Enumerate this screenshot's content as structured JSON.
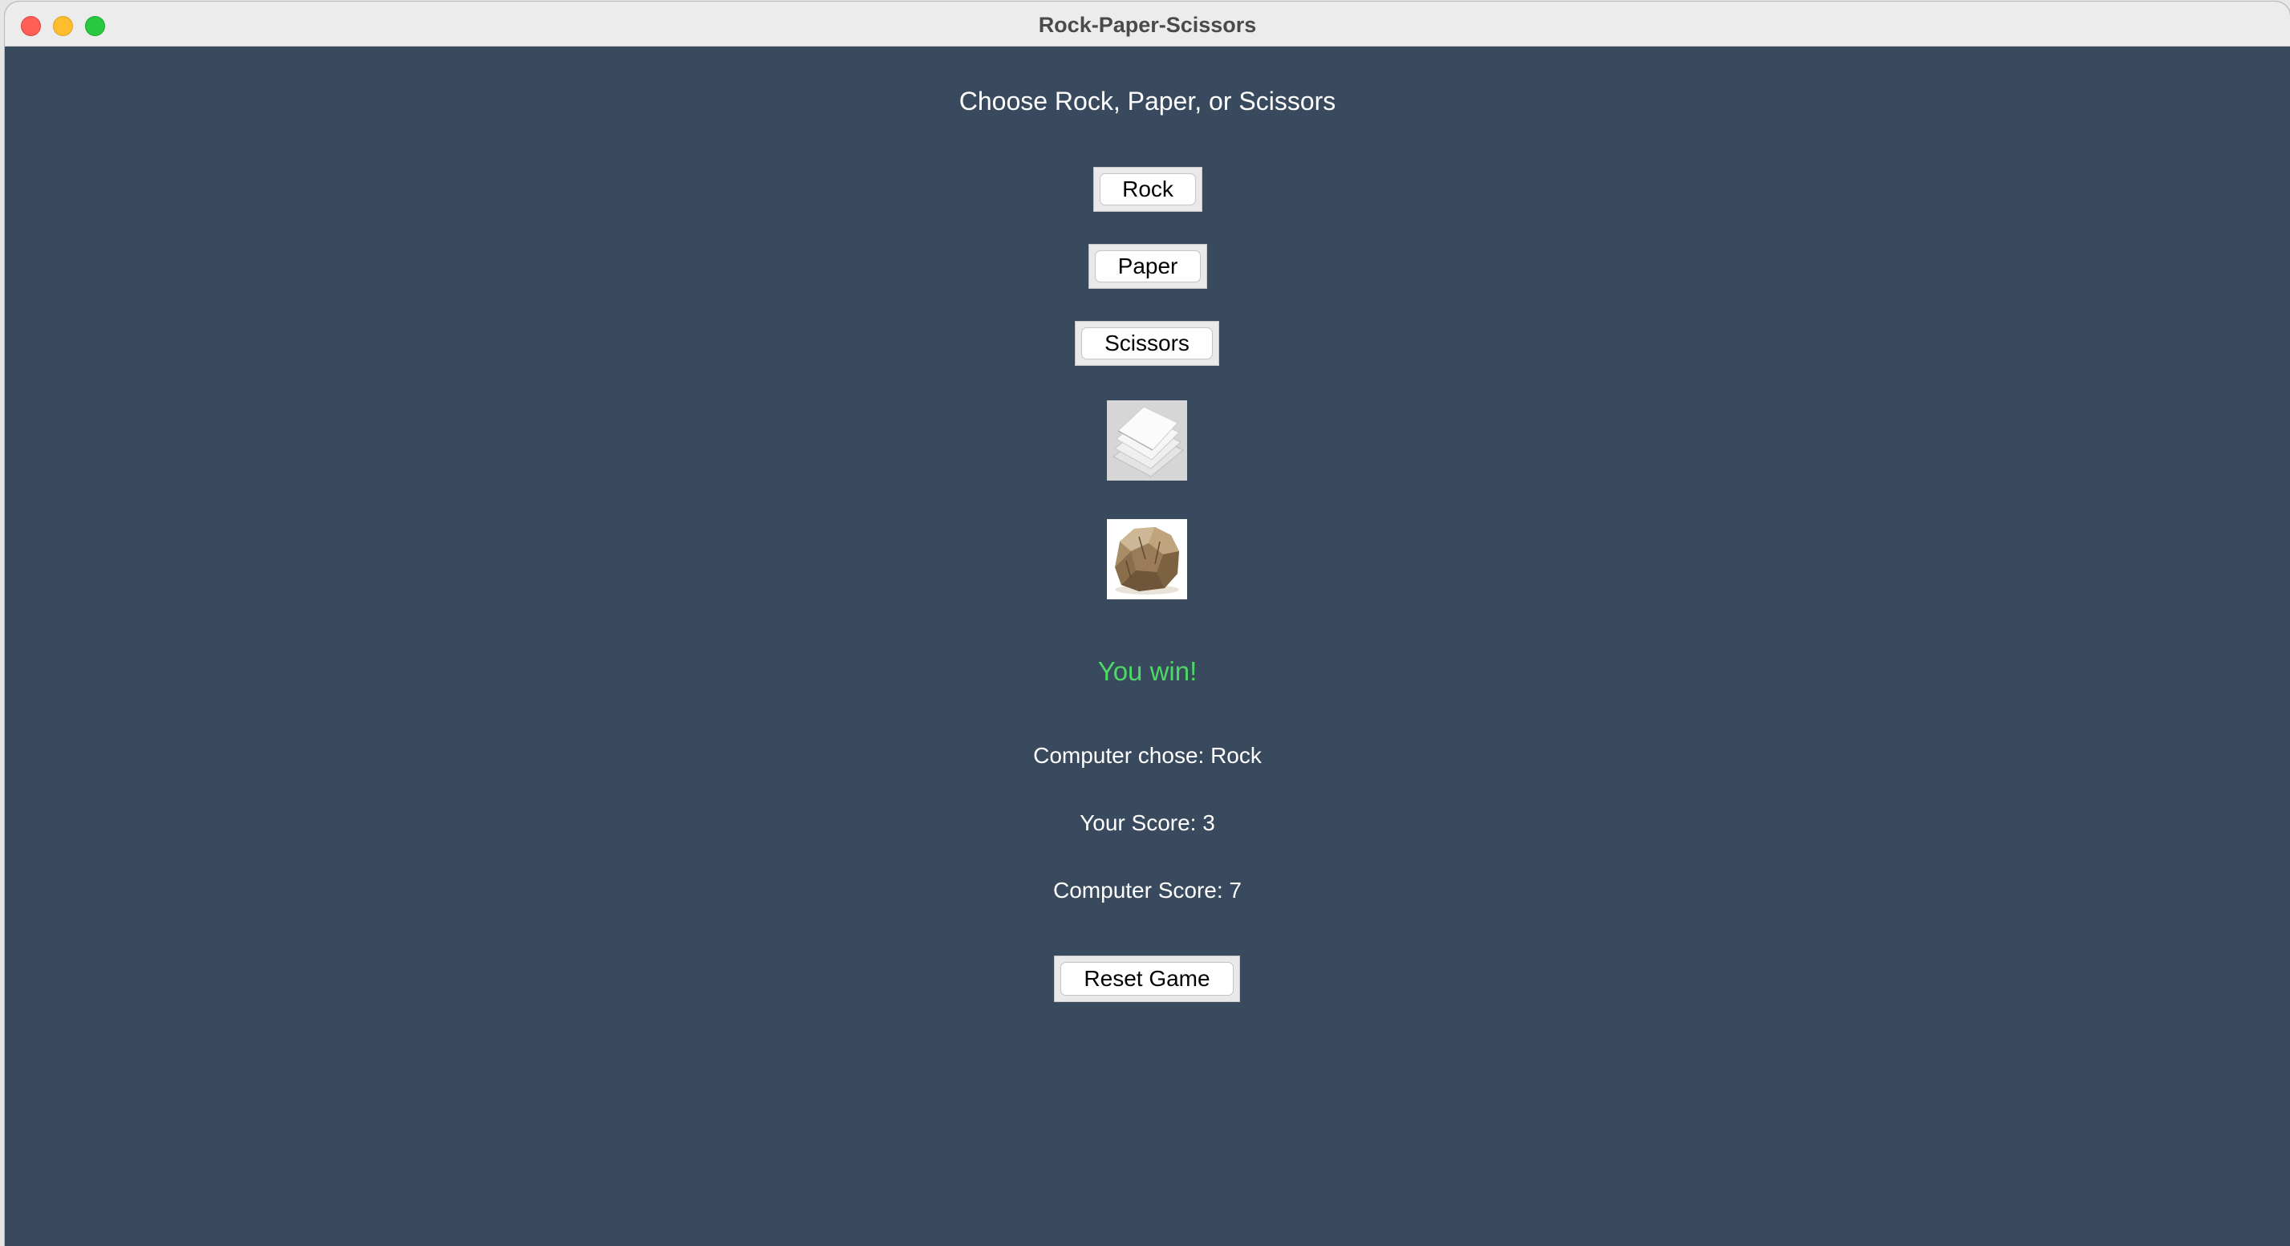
{
  "window": {
    "title": "Rock-Paper-Scissors"
  },
  "prompt": "Choose Rock, Paper, or Scissors",
  "buttons": {
    "rock": "Rock",
    "paper": "Paper",
    "scissors": "Scissors",
    "reset": "Reset Game"
  },
  "images": {
    "player_choice": "paper-image",
    "computer_choice": "rock-image"
  },
  "result": {
    "text": "You win!",
    "color": "#4cd964"
  },
  "computer_choice_text": "Computer chose: Rock",
  "player_score_text": "Your Score: 3",
  "computer_score_text": "Computer Score: 7",
  "colors": {
    "background": "#394a5e",
    "win_text": "#4cd964"
  }
}
